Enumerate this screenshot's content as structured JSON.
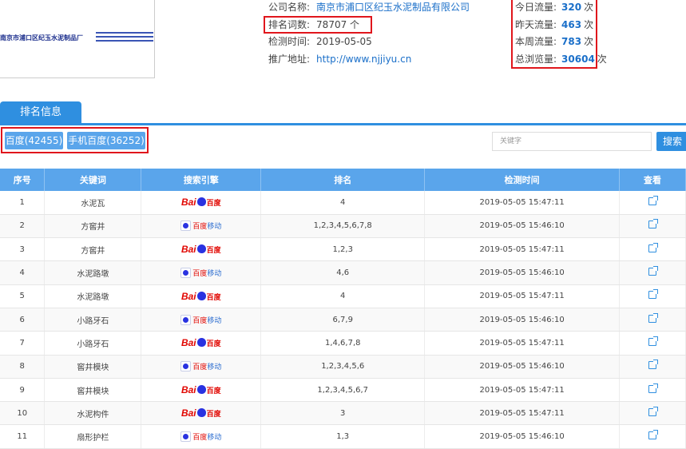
{
  "logo": {
    "company_name": "南京市浦口区纪玉水泥制品厂"
  },
  "company_info": {
    "company_label": "公司名称:",
    "company_value": "南京市浦口区纪玉水泥制品有限公司",
    "words_label": "排名词数:",
    "words_value": "78707 个",
    "date_label": "检测时间:",
    "date_value": "2019-05-05",
    "url_label": "推广地址:",
    "url_value": "http://www.njjiyu.cn"
  },
  "traffic": [
    {
      "label": "今日流量:",
      "value": "320",
      "unit": "次"
    },
    {
      "label": "昨天流量:",
      "value": "463",
      "unit": "次"
    },
    {
      "label": "本周流量:",
      "value": "783",
      "unit": "次"
    },
    {
      "label": "总浏览量:",
      "value": "30604",
      "unit": "次"
    }
  ],
  "tab": {
    "label": "排名信息"
  },
  "engines": {
    "baidu": "百度(42455)",
    "mobile": "手机百度(36252)"
  },
  "search": {
    "placeholder": "关键字",
    "button": "搜索"
  },
  "table": {
    "headers": [
      "序号",
      "关键词",
      "搜索引擎",
      "排名",
      "检测时间",
      "查看"
    ],
    "rows": [
      {
        "no": "1",
        "keyword": "水泥瓦",
        "engine": "baidu",
        "rank": "4",
        "time": "2019-05-05 15:47:11"
      },
      {
        "no": "2",
        "keyword": "方窖井",
        "engine": "mobile",
        "rank": "1,2,3,4,5,6,7,8",
        "time": "2019-05-05 15:46:10"
      },
      {
        "no": "3",
        "keyword": "方窖井",
        "engine": "baidu",
        "rank": "1,2,3",
        "time": "2019-05-05 15:47:11"
      },
      {
        "no": "4",
        "keyword": "水泥路墩",
        "engine": "mobile",
        "rank": "4,6",
        "time": "2019-05-05 15:46:10"
      },
      {
        "no": "5",
        "keyword": "水泥路墩",
        "engine": "baidu",
        "rank": "4",
        "time": "2019-05-05 15:47:11"
      },
      {
        "no": "6",
        "keyword": "小路牙石",
        "engine": "mobile",
        "rank": "6,7,9",
        "time": "2019-05-05 15:46:10"
      },
      {
        "no": "7",
        "keyword": "小路牙石",
        "engine": "baidu",
        "rank": "1,4,6,7,8",
        "time": "2019-05-05 15:47:11"
      },
      {
        "no": "8",
        "keyword": "窖井模块",
        "engine": "mobile",
        "rank": "1,2,3,4,5,6",
        "time": "2019-05-05 15:46:10"
      },
      {
        "no": "9",
        "keyword": "窖井模块",
        "engine": "baidu",
        "rank": "1,2,3,4,5,6,7",
        "time": "2019-05-05 15:47:11"
      },
      {
        "no": "10",
        "keyword": "水泥构件",
        "engine": "baidu",
        "rank": "3",
        "time": "2019-05-05 15:47:11"
      },
      {
        "no": "11",
        "keyword": "扇形护栏",
        "engine": "mobile",
        "rank": "1,3",
        "time": "2019-05-05 15:46:10"
      }
    ]
  },
  "logos": {
    "baidu_bai": "Bai",
    "baidu_du": "百度",
    "mobile_a": "百度",
    "mobile_b": "移动"
  },
  "colors": {
    "accent": "#2f8fe0",
    "highlight_box": "#e0161c",
    "link": "#1a6fc9"
  }
}
